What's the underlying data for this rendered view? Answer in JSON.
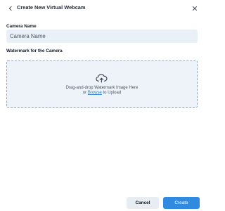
{
  "dialog": {
    "title": "Create New Virtual Webcam",
    "back_icon": "chevron-left-icon",
    "close_icon": "close-icon"
  },
  "camera_name": {
    "label": "Camera Name",
    "value": "Camera Name"
  },
  "watermark": {
    "label": "Watermark for the Camera",
    "icon": "cloud-upload-icon",
    "line1": "Drag-and-drop Watermark Image Here",
    "line2_prefix": "or ",
    "browse_link": "Browse",
    "line2_suffix": " to Upload"
  },
  "buttons": {
    "cancel": "Cancel",
    "create": "Create"
  },
  "colors": {
    "accent": "#2f8ae0",
    "dropzone_bg": "#edf3f9",
    "input_bg": "#e9f0f7",
    "link": "#2a7fd6"
  }
}
